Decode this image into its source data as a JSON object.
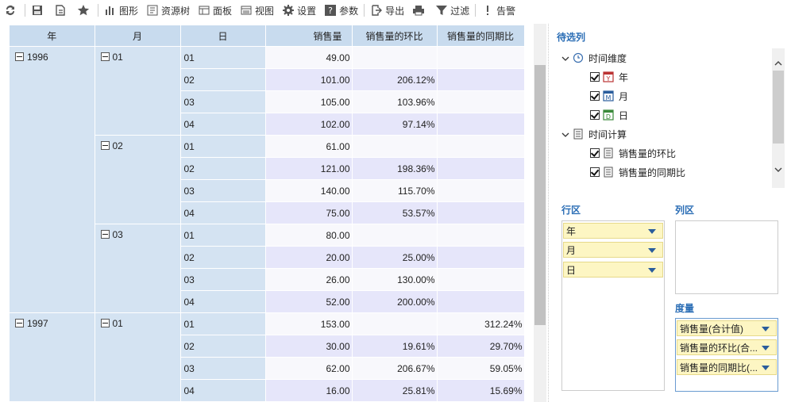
{
  "toolbar": {
    "graph": "图形",
    "resource_tree": "资源树",
    "panel": "面板",
    "view": "视图",
    "settings": "设置",
    "params": "参数",
    "export": "导出",
    "filter": "过滤",
    "alert": "告警"
  },
  "grid": {
    "headers": [
      "年",
      "月",
      "日",
      "销售量",
      "销售量的环比",
      "销售量的同期比"
    ],
    "years": [
      "1996",
      "1997"
    ],
    "months": [
      "01",
      "02",
      "03",
      "01"
    ],
    "rows": [
      {
        "day": "01",
        "sales": "49.00",
        "mom": "",
        "yoy": ""
      },
      {
        "day": "02",
        "sales": "101.00",
        "mom": "206.12%",
        "yoy": ""
      },
      {
        "day": "03",
        "sales": "105.00",
        "mom": "103.96%",
        "yoy": ""
      },
      {
        "day": "04",
        "sales": "102.00",
        "mom": "97.14%",
        "yoy": ""
      },
      {
        "day": "01",
        "sales": "61.00",
        "mom": "",
        "yoy": ""
      },
      {
        "day": "02",
        "sales": "121.00",
        "mom": "198.36%",
        "yoy": ""
      },
      {
        "day": "03",
        "sales": "140.00",
        "mom": "115.70%",
        "yoy": ""
      },
      {
        "day": "04",
        "sales": "75.00",
        "mom": "53.57%",
        "yoy": ""
      },
      {
        "day": "01",
        "sales": "80.00",
        "mom": "",
        "yoy": ""
      },
      {
        "day": "02",
        "sales": "20.00",
        "mom": "25.00%",
        "yoy": ""
      },
      {
        "day": "03",
        "sales": "26.00",
        "mom": "130.00%",
        "yoy": ""
      },
      {
        "day": "04",
        "sales": "52.00",
        "mom": "200.00%",
        "yoy": ""
      },
      {
        "day": "01",
        "sales": "153.00",
        "mom": "",
        "yoy": "312.24%"
      },
      {
        "day": "02",
        "sales": "30.00",
        "mom": "19.61%",
        "yoy": "29.70%"
      },
      {
        "day": "03",
        "sales": "62.00",
        "mom": "206.67%",
        "yoy": "59.05%"
      },
      {
        "day": "04",
        "sales": "16.00",
        "mom": "25.81%",
        "yoy": "15.69%"
      }
    ]
  },
  "panel": {
    "candidates_title": "待选列",
    "tree": {
      "time_dim": "时间维度",
      "year": "年",
      "month": "月",
      "day": "日",
      "time_calc": "时间计算",
      "mom": "销售量的环比",
      "yoy": "销售量的同期比"
    },
    "row_zone_title": "行区",
    "col_zone_title": "列区",
    "measure_title": "度量",
    "row_fields": [
      "年",
      "月",
      "日"
    ],
    "measure_fields": [
      "销售量(合计值)",
      "销售量的环比(合...",
      "销售量的同期比(..."
    ]
  },
  "colors": {
    "header_bg": "#c8dbee",
    "dim_bg": "#d4e3f2",
    "row_odd": "#f8f8fc",
    "row_even": "#e6e6fa",
    "accent": "#2a6db5",
    "field_bg": "#fdf6c3"
  }
}
